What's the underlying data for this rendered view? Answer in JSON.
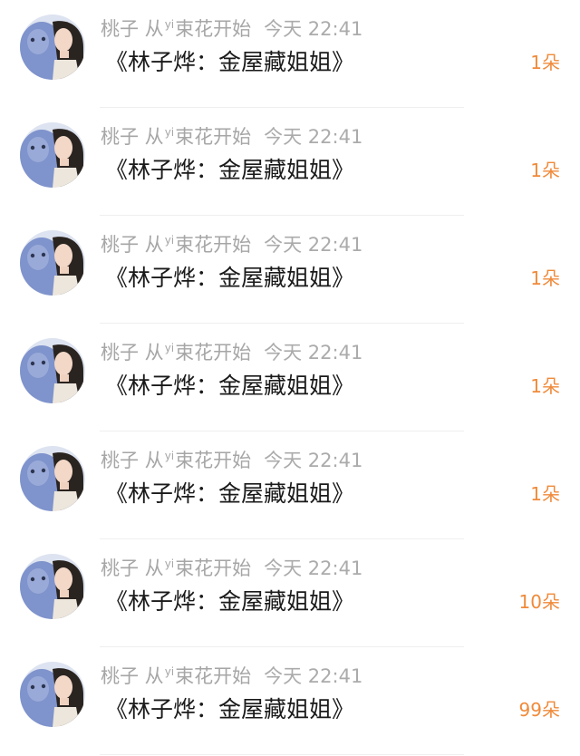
{
  "colors": {
    "meta_text": "#a6a6a6",
    "title_text": "#1a1a1a",
    "count_accent": "#f08a3a",
    "divider": "#efefef"
  },
  "items": [
    {
      "sender_pre": "桃子 从",
      "sender_sup": "yi",
      "sender_post": "束花开始",
      "time": "今天 22:41",
      "title": "《林子烨：金屋藏姐姐》",
      "count": "1朵"
    },
    {
      "sender_pre": "桃子 从",
      "sender_sup": "yi",
      "sender_post": "束花开始",
      "time": "今天 22:41",
      "title": "《林子烨：金屋藏姐姐》",
      "count": "1朵"
    },
    {
      "sender_pre": "桃子 从",
      "sender_sup": "yi",
      "sender_post": "束花开始",
      "time": "今天 22:41",
      "title": "《林子烨：金屋藏姐姐》",
      "count": "1朵"
    },
    {
      "sender_pre": "桃子 从",
      "sender_sup": "yi",
      "sender_post": "束花开始",
      "time": "今天 22:41",
      "title": "《林子烨：金屋藏姐姐》",
      "count": "1朵"
    },
    {
      "sender_pre": "桃子 从",
      "sender_sup": "yi",
      "sender_post": "束花开始",
      "time": "今天 22:41",
      "title": "《林子烨：金屋藏姐姐》",
      "count": "1朵"
    },
    {
      "sender_pre": "桃子 从",
      "sender_sup": "yi",
      "sender_post": "束花开始",
      "time": "今天 22:41",
      "title": "《林子烨：金屋藏姐姐》",
      "count": "10朵"
    },
    {
      "sender_pre": "桃子 从",
      "sender_sup": "yi",
      "sender_post": "束花开始",
      "time": "今天 22:41",
      "title": "《林子烨：金屋藏姐姐》",
      "count": "99朵"
    }
  ]
}
